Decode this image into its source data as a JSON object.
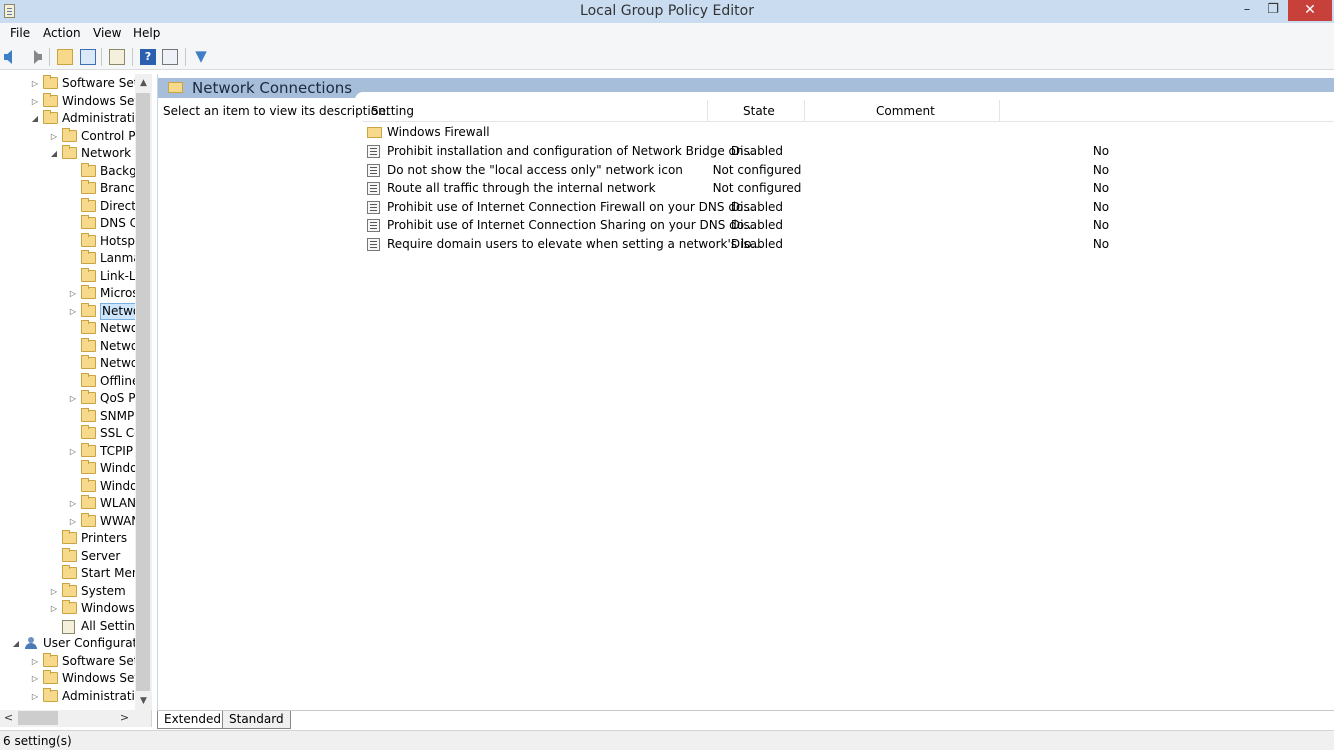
{
  "window": {
    "title": "Local Group Policy Editor",
    "minimize": "–",
    "maximize": "❐",
    "close": "✕"
  },
  "menu": {
    "items": [
      "File",
      "Action",
      "View",
      "Help"
    ]
  },
  "toolbar": {
    "icons": [
      "back-icon",
      "forward-icon",
      "up-folder-icon",
      "show-hide-tree-icon",
      "export-list-icon",
      "help-icon",
      "properties-icon",
      "filter-icon"
    ]
  },
  "tree": {
    "items": [
      {
        "label": "Software Setti",
        "expander": "▷"
      },
      {
        "label": "Windows Sett",
        "expander": "▷"
      },
      {
        "label": "Administrative",
        "expander": "◢"
      },
      {
        "label": "Control Pa",
        "expander": "▷"
      },
      {
        "label": "Network",
        "expander": "◢"
      },
      {
        "label": "Backgr",
        "expander": ""
      },
      {
        "label": "Branch",
        "expander": ""
      },
      {
        "label": "DirectA",
        "expander": ""
      },
      {
        "label": "DNS C",
        "expander": ""
      },
      {
        "label": "Hotspo",
        "expander": ""
      },
      {
        "label": "Lanma",
        "expander": ""
      },
      {
        "label": "Link-La",
        "expander": ""
      },
      {
        "label": "Micros",
        "expander": "▷"
      },
      {
        "label": "Netwo",
        "expander": "▷"
      },
      {
        "label": "Netwo",
        "expander": ""
      },
      {
        "label": "Netwo",
        "expander": ""
      },
      {
        "label": "Netwo",
        "expander": ""
      },
      {
        "label": "Offline",
        "expander": ""
      },
      {
        "label": "QoS Pa",
        "expander": "▷"
      },
      {
        "label": "SNMP",
        "expander": ""
      },
      {
        "label": "SSL Co",
        "expander": ""
      },
      {
        "label": "TCPIP",
        "expander": "▷"
      },
      {
        "label": "Windo",
        "expander": ""
      },
      {
        "label": "Windo",
        "expander": ""
      },
      {
        "label": "WLAN",
        "expander": "▷"
      },
      {
        "label": "WWAN",
        "expander": "▷"
      },
      {
        "label": "Printers",
        "expander": ""
      },
      {
        "label": "Server",
        "expander": ""
      },
      {
        "label": "Start Menu",
        "expander": ""
      },
      {
        "label": "System",
        "expander": "▷"
      },
      {
        "label": "Windows (",
        "expander": "▷"
      },
      {
        "label": "All Setting",
        "expander": ""
      },
      {
        "label": "User Configuratio",
        "expander": "◢"
      },
      {
        "label": "Software Setti",
        "expander": "▷"
      },
      {
        "label": "Windows Sett",
        "expander": "▷"
      },
      {
        "label": "Administrative",
        "expander": "▷"
      }
    ],
    "selected_label": "Netwo"
  },
  "content": {
    "header_title": "Network Connections",
    "description_prompt": "Select an item to view its description.",
    "columns": {
      "setting": "Setting",
      "state": "State",
      "comment": "Comment"
    },
    "folder_row": "Windows Firewall",
    "rows": [
      {
        "name": "Prohibit installation and configuration of Network Bridge on...",
        "state": "Disabled",
        "comment": "No"
      },
      {
        "name": "Do not show the \"local access only\" network icon",
        "state": "Not configured",
        "comment": "No"
      },
      {
        "name": "Route all traffic through the internal network",
        "state": "Not configured",
        "comment": "No"
      },
      {
        "name": "Prohibit use of Internet Connection Firewall on your DNS do...",
        "state": "Disabled",
        "comment": "No"
      },
      {
        "name": "Prohibit use of Internet Connection Sharing on your DNS do...",
        "state": "Disabled",
        "comment": "No"
      },
      {
        "name": "Require domain users to elevate when setting a network's lo...",
        "state": "Disabled",
        "comment": "No"
      }
    ]
  },
  "tabs": {
    "extended": "Extended",
    "standard": "Standard"
  },
  "status": {
    "text": "6 setting(s)"
  }
}
